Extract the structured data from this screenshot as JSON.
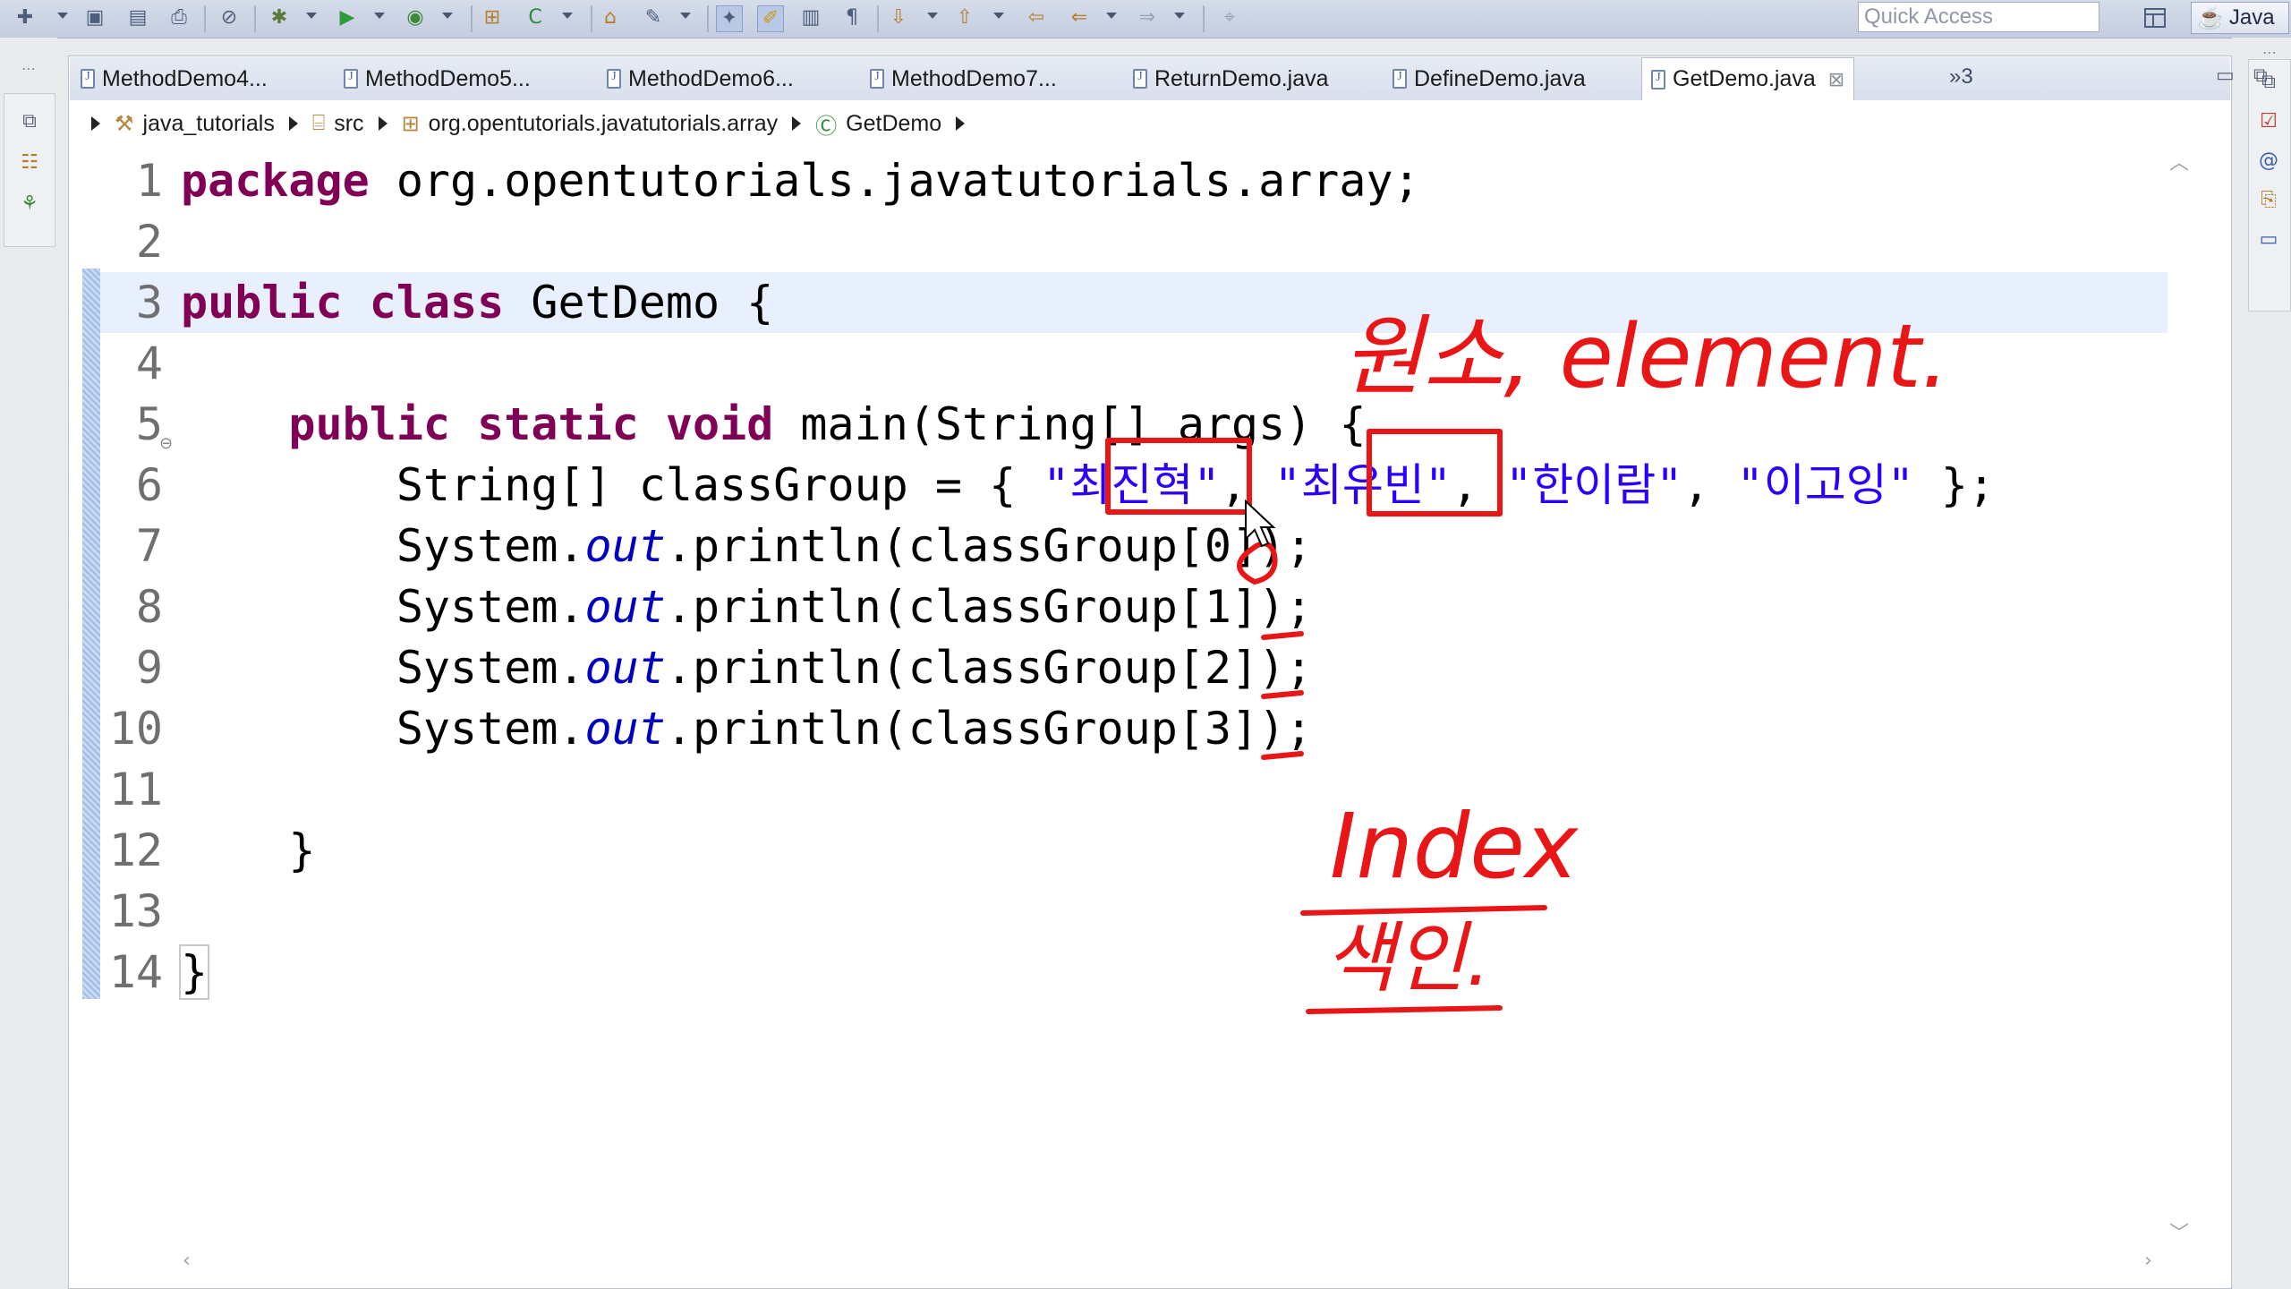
{
  "toolbar": {
    "quick_access_placeholder": "Quick Access",
    "perspective_label": "Java",
    "icons": [
      "new-icon",
      "save-icon",
      "save-all-icon",
      "print-icon",
      "skip-breakpoints-icon",
      "debug-icon",
      "run-icon",
      "run-coverage-icon",
      "new-package-icon",
      "new-class-icon",
      "open-type-icon",
      "search-icon",
      "toggle-mark-occurrences-icon",
      "toggle-highlight-icon",
      "block-selection-icon",
      "show-whitespace-icon",
      "next-annotation-icon",
      "previous-annotation-icon",
      "last-edit-icon",
      "back-icon",
      "forward-icon",
      "pin-editor-icon"
    ]
  },
  "tabs": [
    {
      "label": "MethodDemo4..."
    },
    {
      "label": "MethodDemo5..."
    },
    {
      "label": "MethodDemo6..."
    },
    {
      "label": "MethodDemo7..."
    },
    {
      "label": "ReturnDemo.java"
    },
    {
      "label": "DefineDemo.java"
    },
    {
      "label": "GetDemo.java",
      "active": true
    }
  ],
  "more_tabs": "»3",
  "breadcrumb": [
    "java_tutorials",
    "src",
    "org.opentutorials.javatutorials.array",
    "GetDemo"
  ],
  "code": {
    "line_numbers": [
      "1",
      "2",
      "3",
      "4",
      "5",
      "6",
      "7",
      "8",
      "9",
      "10",
      "11",
      "12",
      "13",
      "14"
    ],
    "l1_kw": "package",
    "l1_rest": " org.opentutorials.javatutorials.array;",
    "l3_kw1": "public",
    "l3_kw2": "class",
    "l3_rest": " GetDemo {",
    "l5_indent": "    ",
    "l5_kw1": "public",
    "l5_kw2": "static",
    "l5_kw3": "void",
    "l5_rest": " main(String[] args) {",
    "l6_pre": "        String[] classGroup = { ",
    "l6_s1": "\"최진혁\"",
    "l6_sep1": ", ",
    "l6_s2": "\"최유빈\"",
    "l6_sep2": ", ",
    "l6_s3": "\"한이람\"",
    "l6_sep3": ", ",
    "l6_s4": "\"이고잉\"",
    "l6_post": " };",
    "print_pre": "        System.",
    "print_field": "out",
    "print_mid": ".println(classGroup[",
    "print_idx": [
      "0",
      "1",
      "2",
      "3"
    ],
    "print_post": "]);",
    "l12": "    }",
    "l14": "}"
  },
  "annotations": {
    "element_note": "원소, element.",
    "index_note": "Index",
    "index_korean": "색인."
  },
  "colors": {
    "keyword": "#7f0055",
    "string": "#2a00ff",
    "static_field": "#0000c0",
    "annotation": "#e81616",
    "current_line": "#e8f0fd"
  }
}
